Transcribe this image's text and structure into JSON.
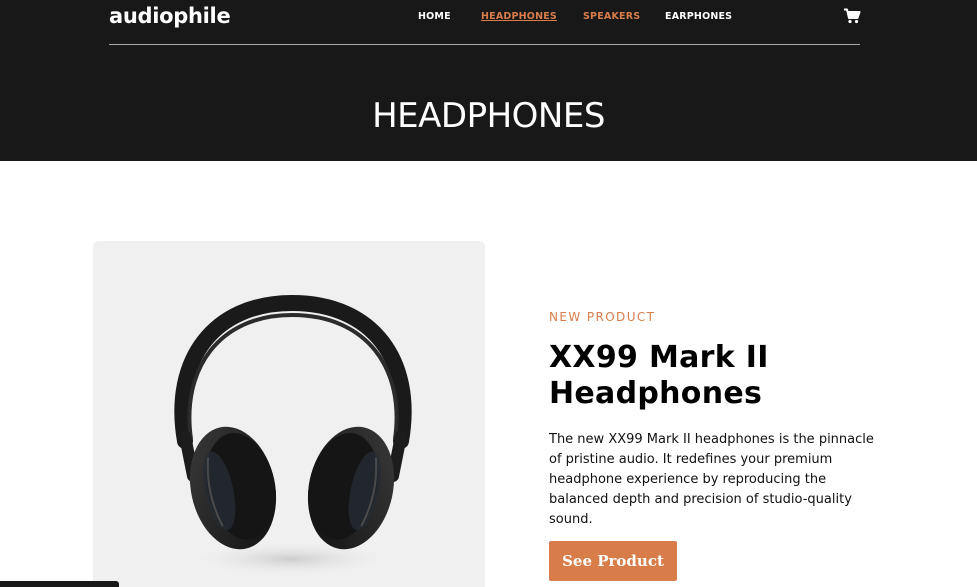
{
  "brand": {
    "logo": "audiophile"
  },
  "nav": {
    "items": [
      {
        "label": "HOME"
      },
      {
        "label": "HEADPHONES"
      },
      {
        "label": "SPEAKERS"
      },
      {
        "label": "EARPHONES"
      }
    ],
    "cart_icon": "cart-icon"
  },
  "category": {
    "title": "HEADPHONES"
  },
  "product": {
    "overline": "NEW PRODUCT",
    "name": "XX99 Mark II Headphones",
    "description": "The new XX99 Mark II headphones is the pinnacle of pristine audio. It redefines your premium headphone experience by reproducing the balanced depth and precision of studio-quality sound.",
    "button_label": "See Product",
    "image_icon": "headphones-image"
  },
  "colors": {
    "header_bg": "#191818",
    "accent": "#d87d4a",
    "image_bg": "#f0f0f0",
    "text_dark": "#000000",
    "text_light": "#ffffff"
  }
}
